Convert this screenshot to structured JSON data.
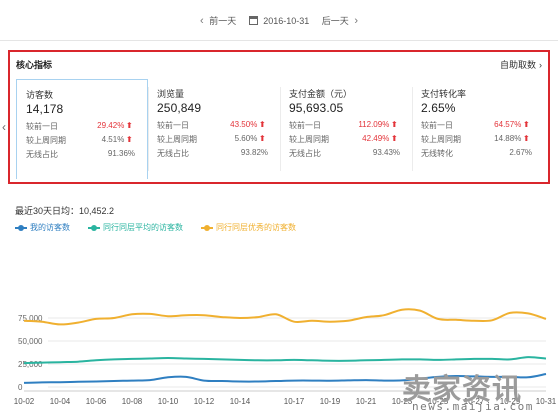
{
  "date_nav": {
    "prev_label": "前一天",
    "date": "2016-10-31",
    "next_label": "后一天"
  },
  "core": {
    "title": "核心指标",
    "auto_fetch_label": "自助取数",
    "cards": [
      {
        "label": "访客数",
        "value": "14,178",
        "rows": [
          {
            "label": "较前一日",
            "value": "29.42%",
            "up": true
          },
          {
            "label": "较上周同期",
            "value": "4.51%",
            "up": true
          },
          {
            "label": "无线占比",
            "value": "91.36%",
            "up": false
          }
        ]
      },
      {
        "label": "浏览量",
        "value": "250,849",
        "rows": [
          {
            "label": "较前一日",
            "value": "43.50%",
            "up": true
          },
          {
            "label": "较上周同期",
            "value": "5.60%",
            "up": true
          },
          {
            "label": "无线占比",
            "value": "93.82%",
            "up": false
          }
        ]
      },
      {
        "label": "支付金额（元）",
        "value": "95,693.05",
        "rows": [
          {
            "label": "较前一日",
            "value": "112.09%",
            "up": true
          },
          {
            "label": "较上周同期",
            "value": "42.49%",
            "up": true
          },
          {
            "label": "无线占比",
            "value": "93.43%",
            "up": false
          }
        ]
      },
      {
        "label": "支付转化率",
        "value": "2.65%",
        "rows": [
          {
            "label": "较前一日",
            "value": "64.57%",
            "up": true
          },
          {
            "label": "较上周同期",
            "value": "14.88%",
            "up": true
          },
          {
            "label": "无线转化",
            "value": "2.67%",
            "up": false
          }
        ]
      }
    ]
  },
  "chart_data": {
    "type": "line",
    "title": "最近30天日均：10,452.2",
    "ylim": [
      0,
      100000
    ],
    "y_ticks": [
      "0",
      "25,000",
      "50,000",
      "75,000"
    ],
    "x_tick_labels": [
      "10-02",
      "10-04",
      "10-06",
      "10-08",
      "10-10",
      "10-12",
      "10-14",
      "10-17",
      "10-19",
      "10-21",
      "10-23",
      "10-25",
      "10-27",
      "10-29",
      "10-31"
    ],
    "x": [
      "10-02",
      "10-03",
      "10-04",
      "10-05",
      "10-06",
      "10-07",
      "10-08",
      "10-09",
      "10-10",
      "10-11",
      "10-12",
      "10-13",
      "10-14",
      "10-15",
      "10-16",
      "10-17",
      "10-18",
      "10-19",
      "10-20",
      "10-21",
      "10-22",
      "10-23",
      "10-24",
      "10-25",
      "10-26",
      "10-27",
      "10-28",
      "10-29",
      "10-30",
      "10-31"
    ],
    "grid": true,
    "legend_position": "top-left",
    "series": [
      {
        "name": "我的访客数",
        "color": "#2f7fc1",
        "values": [
          4500,
          5000,
          5200,
          5600,
          6000,
          6500,
          7000,
          7500,
          10500,
          11000,
          7000,
          6500,
          6000,
          6000,
          6500,
          7000,
          7000,
          6800,
          7200,
          7500,
          7000,
          7200,
          9000,
          11000,
          12000,
          11500,
          11000,
          11000,
          10500,
          14178
        ]
      },
      {
        "name": "同行同层平均的访客数",
        "color": "#2ab4a0",
        "values": [
          26000,
          26500,
          27000,
          27500,
          29000,
          30000,
          30500,
          31000,
          31500,
          31000,
          30500,
          30000,
          29500,
          29000,
          29000,
          29500,
          29000,
          28500,
          28500,
          29000,
          29500,
          30000,
          30000,
          29500,
          30000,
          30500,
          30500,
          30000,
          32500,
          31000
        ]
      },
      {
        "name": "同行同层优秀的访客数",
        "color": "#f0b030",
        "values": [
          72000,
          71000,
          68000,
          70000,
          74000,
          75000,
          79000,
          79500,
          77000,
          78000,
          78000,
          76000,
          75000,
          76000,
          79000,
          71000,
          72000,
          71000,
          72000,
          76000,
          78000,
          84000,
          83000,
          74000,
          73000,
          72000,
          72500,
          80500,
          80000,
          74000
        ]
      }
    ]
  },
  "watermark": {
    "logo_text": "卖家资讯",
    "url": "news.maijia.com"
  }
}
